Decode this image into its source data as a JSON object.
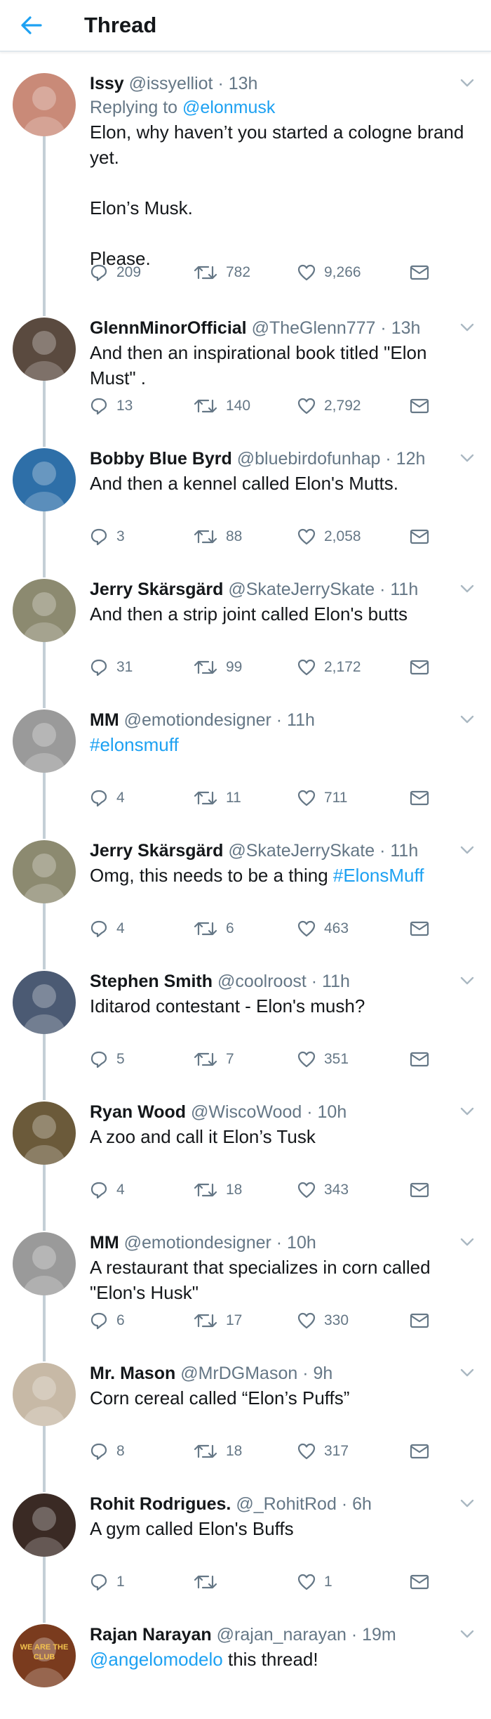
{
  "header": {
    "title": "Thread"
  },
  "tweets": [
    {
      "name": "Issy",
      "handle": "@issyelliot",
      "time": "· 13h",
      "reply_prefix": "Replying to ",
      "reply_to": "@elonmusk",
      "text": "Elon, why haven’t you started a cologne brand yet.\n\nElon’s Musk.\n\nPlease.",
      "replies": "209",
      "retweets": "782",
      "likes": "9,266",
      "avatar_color": "#c98a78"
    },
    {
      "name": "GlennMinorOfficial",
      "handle": "@TheGlenn777",
      "time": "· 13h",
      "text": "And then an inspirational book titled \"Elon Must\" .",
      "replies": "13",
      "retweets": "140",
      "likes": "2,792",
      "avatar_color": "#5a4a3f"
    },
    {
      "name": "Bobby Blue Byrd",
      "handle": "@bluebirdofunhap",
      "time": "· 12h",
      "text": "And then a kennel called Elon's Mutts.",
      "replies": "3",
      "retweets": "88",
      "likes": "2,058",
      "avatar_color": "#2e6fa8"
    },
    {
      "name": "Jerry Skärsgärd",
      "handle": "@SkateJerrySkate",
      "time": "· 11h",
      "text": "And then a strip joint called Elon's butts",
      "replies": "31",
      "retweets": "99",
      "likes": "2,172",
      "avatar_color": "#8c8a70"
    },
    {
      "name": "MM",
      "handle": "@emotiondesigner",
      "time": "· 11h",
      "text_link": "#elonsmuff",
      "replies": "4",
      "retweets": "11",
      "likes": "711",
      "avatar_color": "#9a9a9a"
    },
    {
      "name": "Jerry Skärsgärd",
      "handle": "@SkateJerrySkate",
      "time": "· 11h",
      "text": "Omg, this needs to be a thing ",
      "text_link": "#ElonsMuff",
      "replies": "4",
      "retweets": "6",
      "likes": "463",
      "avatar_color": "#8c8a70"
    },
    {
      "name": "Stephen Smith",
      "handle": "@coolroost",
      "time": "· 11h",
      "text": "Iditarod contestant - Elon's mush?",
      "replies": "5",
      "retweets": "7",
      "likes": "351",
      "avatar_color": "#4b5a73"
    },
    {
      "name": "Ryan Wood",
      "handle": "@WiscoWood",
      "time": "· 10h",
      "text": "A zoo and call it Elon’s Tusk",
      "replies": "4",
      "retweets": "18",
      "likes": "343",
      "avatar_color": "#6b5a3a"
    },
    {
      "name": "MM",
      "handle": "@emotiondesigner",
      "time": "· 10h",
      "text": "A restaurant that specializes in corn called \"Elon's Husk\"",
      "replies": "6",
      "retweets": "17",
      "likes": "330",
      "avatar_color": "#9a9a9a"
    },
    {
      "name": "Mr. Mason",
      "handle": "@MrDGMason",
      "time": "· 9h",
      "text": "Corn cereal called “Elon’s Puffs”",
      "replies": "8",
      "retweets": "18",
      "likes": "317",
      "avatar_color": "#c7b9a6"
    },
    {
      "name": "Rohit Rodrigues.",
      "handle": "@_RohitRod",
      "time": "· 6h",
      "text": "A gym called Elon's Buffs",
      "replies": "1",
      "retweets": "",
      "likes": "1",
      "avatar_color": "#3a2a24"
    },
    {
      "name": "Rajan Narayan",
      "handle": "@rajan_narayan",
      "time": "· 19m",
      "text_link_prefix": "@angelomodelo",
      "text": " this thread!",
      "avatar_color": "#7a3b1e",
      "avatar_text": "WE ARE THE\nCLUB"
    }
  ]
}
